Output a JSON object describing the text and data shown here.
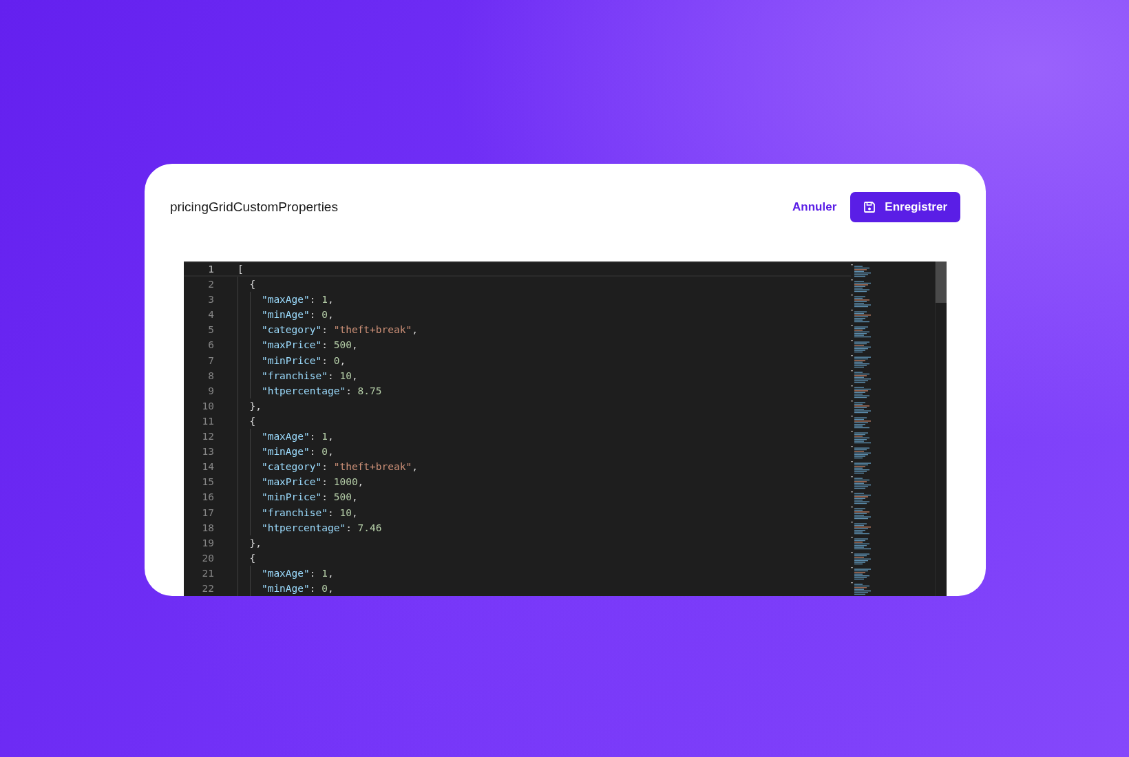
{
  "dialog": {
    "title": "pricingGridCustomProperties",
    "buttons": [
      {
        "kind": "link",
        "label": "Annuler"
      },
      {
        "kind": "primary",
        "label": "Enregistrer"
      }
    ]
  },
  "editor": {
    "lines": [
      {
        "number": "1",
        "current": true,
        "tokens": [
          {
            "kind": "punct",
            "text": "["
          }
        ]
      },
      {
        "number": "2",
        "tokens": [
          {
            "kind": "punct",
            "text": "  {"
          }
        ]
      },
      {
        "number": "3",
        "tokens": [
          {
            "kind": "key",
            "text": "    \"maxAge\""
          },
          {
            "kind": "punct",
            "text": ": "
          },
          {
            "kind": "number",
            "text": "1"
          },
          {
            "kind": "punct",
            "text": ","
          }
        ]
      },
      {
        "number": "4",
        "tokens": [
          {
            "kind": "key",
            "text": "    \"minAge\""
          },
          {
            "kind": "punct",
            "text": ": "
          },
          {
            "kind": "number",
            "text": "0"
          },
          {
            "kind": "punct",
            "text": ","
          }
        ]
      },
      {
        "number": "5",
        "tokens": [
          {
            "kind": "key",
            "text": "    \"category\""
          },
          {
            "kind": "punct",
            "text": ": "
          },
          {
            "kind": "string",
            "text": "\"theft+break\""
          },
          {
            "kind": "punct",
            "text": ","
          }
        ]
      },
      {
        "number": "6",
        "tokens": [
          {
            "kind": "key",
            "text": "    \"maxPrice\""
          },
          {
            "kind": "punct",
            "text": ": "
          },
          {
            "kind": "number",
            "text": "500"
          },
          {
            "kind": "punct",
            "text": ","
          }
        ]
      },
      {
        "number": "7",
        "tokens": [
          {
            "kind": "key",
            "text": "    \"minPrice\""
          },
          {
            "kind": "punct",
            "text": ": "
          },
          {
            "kind": "number",
            "text": "0"
          },
          {
            "kind": "punct",
            "text": ","
          }
        ]
      },
      {
        "number": "8",
        "tokens": [
          {
            "kind": "key",
            "text": "    \"franchise\""
          },
          {
            "kind": "punct",
            "text": ": "
          },
          {
            "kind": "number",
            "text": "10"
          },
          {
            "kind": "punct",
            "text": ","
          }
        ]
      },
      {
        "number": "9",
        "tokens": [
          {
            "kind": "key",
            "text": "    \"htpercentage\""
          },
          {
            "kind": "punct",
            "text": ": "
          },
          {
            "kind": "number",
            "text": "8.75"
          }
        ]
      },
      {
        "number": "10",
        "tokens": [
          {
            "kind": "punct",
            "text": "  },"
          }
        ]
      },
      {
        "number": "11",
        "tokens": [
          {
            "kind": "punct",
            "text": "  {"
          }
        ]
      },
      {
        "number": "12",
        "tokens": [
          {
            "kind": "key",
            "text": "    \"maxAge\""
          },
          {
            "kind": "punct",
            "text": ": "
          },
          {
            "kind": "number",
            "text": "1"
          },
          {
            "kind": "punct",
            "text": ","
          }
        ]
      },
      {
        "number": "13",
        "tokens": [
          {
            "kind": "key",
            "text": "    \"minAge\""
          },
          {
            "kind": "punct",
            "text": ": "
          },
          {
            "kind": "number",
            "text": "0"
          },
          {
            "kind": "punct",
            "text": ","
          }
        ]
      },
      {
        "number": "14",
        "tokens": [
          {
            "kind": "key",
            "text": "    \"category\""
          },
          {
            "kind": "punct",
            "text": ": "
          },
          {
            "kind": "string",
            "text": "\"theft+break\""
          },
          {
            "kind": "punct",
            "text": ","
          }
        ]
      },
      {
        "number": "15",
        "tokens": [
          {
            "kind": "key",
            "text": "    \"maxPrice\""
          },
          {
            "kind": "punct",
            "text": ": "
          },
          {
            "kind": "number",
            "text": "1000"
          },
          {
            "kind": "punct",
            "text": ","
          }
        ]
      },
      {
        "number": "16",
        "tokens": [
          {
            "kind": "key",
            "text": "    \"minPrice\""
          },
          {
            "kind": "punct",
            "text": ": "
          },
          {
            "kind": "number",
            "text": "500"
          },
          {
            "kind": "punct",
            "text": ","
          }
        ]
      },
      {
        "number": "17",
        "tokens": [
          {
            "kind": "key",
            "text": "    \"franchise\""
          },
          {
            "kind": "punct",
            "text": ": "
          },
          {
            "kind": "number",
            "text": "10"
          },
          {
            "kind": "punct",
            "text": ","
          }
        ]
      },
      {
        "number": "18",
        "tokens": [
          {
            "kind": "key",
            "text": "    \"htpercentage\""
          },
          {
            "kind": "punct",
            "text": ": "
          },
          {
            "kind": "number",
            "text": "7.46"
          }
        ]
      },
      {
        "number": "19",
        "tokens": [
          {
            "kind": "punct",
            "text": "  },"
          }
        ]
      },
      {
        "number": "20",
        "tokens": [
          {
            "kind": "punct",
            "text": "  {"
          }
        ]
      },
      {
        "number": "21",
        "tokens": [
          {
            "kind": "key",
            "text": "    \"maxAge\""
          },
          {
            "kind": "punct",
            "text": ": "
          },
          {
            "kind": "number",
            "text": "1"
          },
          {
            "kind": "punct",
            "text": ","
          }
        ]
      },
      {
        "number": "22",
        "tokens": [
          {
            "kind": "key",
            "text": "    \"minAge\""
          },
          {
            "kind": "punct",
            "text": ": "
          },
          {
            "kind": "number",
            "text": "0"
          },
          {
            "kind": "punct",
            "text": ","
          }
        ]
      }
    ]
  }
}
